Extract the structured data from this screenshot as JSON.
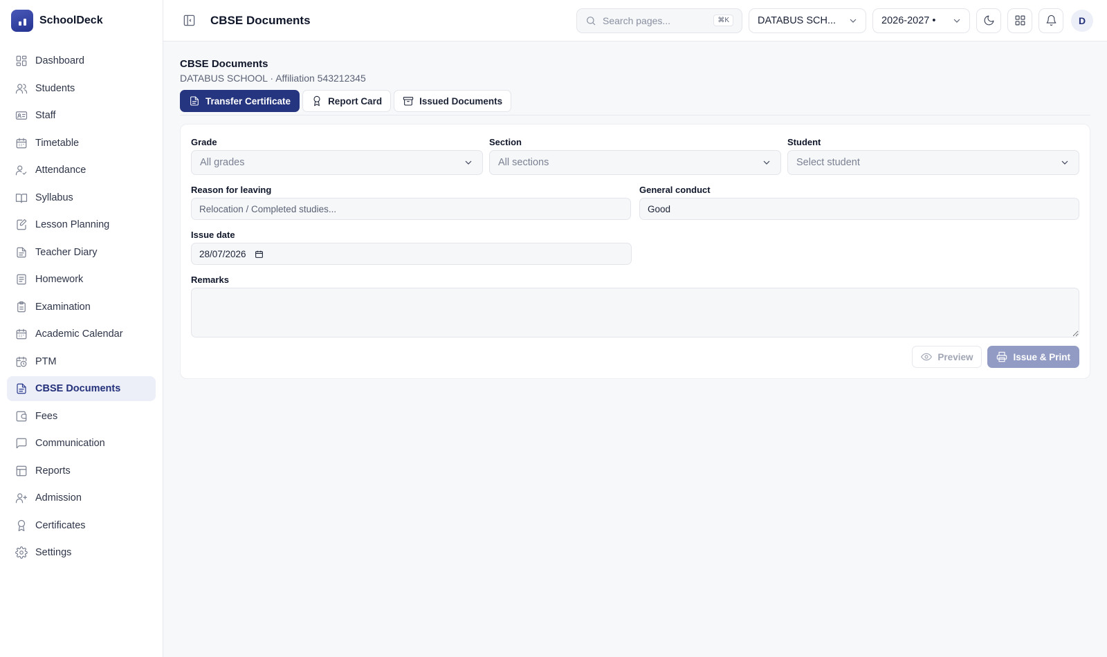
{
  "app": {
    "name": "SchoolDeck"
  },
  "sidebar": {
    "items": [
      {
        "label": "Dashboard",
        "icon": "dashboard-icon"
      },
      {
        "label": "Students",
        "icon": "users-icon"
      },
      {
        "label": "Staff",
        "icon": "id-card-icon"
      },
      {
        "label": "Timetable",
        "icon": "calendar-icon"
      },
      {
        "label": "Attendance",
        "icon": "user-check-icon"
      },
      {
        "label": "Syllabus",
        "icon": "book-open-icon"
      },
      {
        "label": "Lesson Planning",
        "icon": "edit-note-icon"
      },
      {
        "label": "Teacher Diary",
        "icon": "document-icon"
      },
      {
        "label": "Homework",
        "icon": "list-icon"
      },
      {
        "label": "Examination",
        "icon": "clipboard-icon"
      },
      {
        "label": "Academic Calendar",
        "icon": "calendar-icon"
      },
      {
        "label": "PTM",
        "icon": "calendar-clock-icon"
      },
      {
        "label": "CBSE Documents",
        "icon": "document-icon",
        "active": true
      },
      {
        "label": "Fees",
        "icon": "wallet-icon"
      },
      {
        "label": "Communication",
        "icon": "message-icon"
      },
      {
        "label": "Reports",
        "icon": "table-icon"
      },
      {
        "label": "Admission",
        "icon": "user-plus-icon"
      },
      {
        "label": "Certificates",
        "icon": "award-icon"
      },
      {
        "label": "Settings",
        "icon": "gear-icon"
      }
    ]
  },
  "topbar": {
    "title": "CBSE Documents",
    "search_placeholder": "Search pages...",
    "search_shortcut": "⌘K",
    "school_select": "DATABUS SCH...",
    "year_select": "2026-2027 •",
    "avatar_initial": "D"
  },
  "page": {
    "title": "CBSE Documents",
    "subtitle": "DATABUS SCHOOL · Affiliation 543212345"
  },
  "tabs": [
    {
      "label": "Transfer Certificate",
      "icon": "document-icon",
      "active": true
    },
    {
      "label": "Report Card",
      "icon": "award-icon"
    },
    {
      "label": "Issued Documents",
      "icon": "archive-icon"
    }
  ],
  "form": {
    "grade": {
      "label": "Grade",
      "value": "All grades"
    },
    "section": {
      "label": "Section",
      "value": "All sections"
    },
    "student": {
      "label": "Student",
      "value": "Select student"
    },
    "reason": {
      "label": "Reason for leaving",
      "placeholder": "Relocation / Completed studies..."
    },
    "conduct": {
      "label": "General conduct",
      "value": "Good"
    },
    "issue_date": {
      "label": "Issue date",
      "value": "28/07/2026"
    },
    "remarks": {
      "label": "Remarks",
      "value": ""
    }
  },
  "actions": {
    "preview_label": "Preview",
    "issue_label": "Issue & Print"
  },
  "colors": {
    "accent": "#26357f",
    "active_nav_bg": "#eceef8",
    "disabled_primary": "#929bc3"
  }
}
